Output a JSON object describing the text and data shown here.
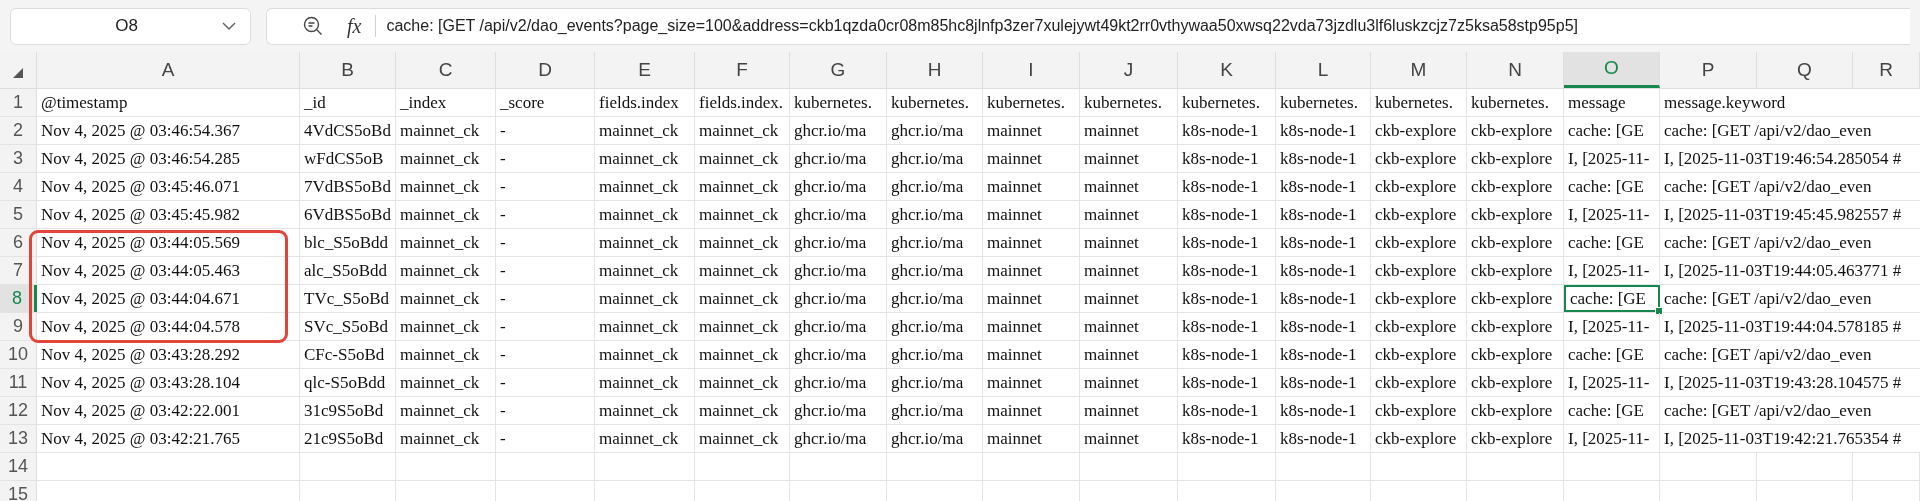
{
  "name_box": {
    "value": "O8"
  },
  "formula_bar": {
    "fx": "fx",
    "value": "cache: [GET /api/v2/dao_events?page_size=100&address=ckb1qzda0cr08m85hc8jlnfp3zer7xulejywt49kt2rr0vthywaa50xwsq22vda73jzdlu3lf6luskzcjz7z5ksa58stp95p5]"
  },
  "columns": [
    {
      "label": "A",
      "selected": false
    },
    {
      "label": "B",
      "selected": false
    },
    {
      "label": "C",
      "selected": false
    },
    {
      "label": "D",
      "selected": false
    },
    {
      "label": "E",
      "selected": false
    },
    {
      "label": "F",
      "selected": false
    },
    {
      "label": "G",
      "selected": false
    },
    {
      "label": "H",
      "selected": false
    },
    {
      "label": "I",
      "selected": false
    },
    {
      "label": "J",
      "selected": false
    },
    {
      "label": "K",
      "selected": false
    },
    {
      "label": "L",
      "selected": false
    },
    {
      "label": "M",
      "selected": false
    },
    {
      "label": "N",
      "selected": false
    },
    {
      "label": "O",
      "selected": true
    },
    {
      "label": "P",
      "selected": false
    },
    {
      "label": "Q",
      "selected": false
    },
    {
      "label": "R",
      "selected": false
    }
  ],
  "rows": [
    {
      "number": "1",
      "selected": false,
      "annotated": false,
      "cells": [
        "@timestamp",
        "_id",
        "_index",
        "_score",
        "fields.index",
        "fields.index.",
        "kubernetes.",
        "kubernetes.",
        "kubernetes.",
        "kubernetes.",
        "kubernetes.",
        "kubernetes.",
        "kubernetes.",
        "kubernetes.",
        "message",
        "message.keyword"
      ]
    },
    {
      "number": "2",
      "selected": false,
      "annotated": false,
      "cells": [
        "Nov 4, 2025 @ 03:46:54.367",
        "4VdCS5oBd",
        "mainnet_ck",
        "-",
        "mainnet_ck",
        "mainnet_ck",
        "ghcr.io/ma",
        "ghcr.io/ma",
        "mainnet",
        "mainnet",
        "k8s-node-1",
        "k8s-node-1",
        "ckb-explore",
        "ckb-explore",
        "cache: [GE",
        "cache: [GET /api/v2/dao_even"
      ]
    },
    {
      "number": "3",
      "selected": false,
      "annotated": false,
      "cells": [
        "Nov 4, 2025 @ 03:46:54.285",
        "wFdCS5oB",
        "mainnet_ck",
        "-",
        "mainnet_ck",
        "mainnet_ck",
        "ghcr.io/ma",
        "ghcr.io/ma",
        "mainnet",
        "mainnet",
        "k8s-node-1",
        "k8s-node-1",
        "ckb-explore",
        "ckb-explore",
        "I, [2025-11-",
        "I, [2025-11-03T19:46:54.285054 #"
      ]
    },
    {
      "number": "4",
      "selected": false,
      "annotated": false,
      "cells": [
        "Nov 4, 2025 @ 03:45:46.071",
        "7VdBS5oBd",
        "mainnet_ck",
        "-",
        "mainnet_ck",
        "mainnet_ck",
        "ghcr.io/ma",
        "ghcr.io/ma",
        "mainnet",
        "mainnet",
        "k8s-node-1",
        "k8s-node-1",
        "ckb-explore",
        "ckb-explore",
        "cache: [GE",
        "cache: [GET /api/v2/dao_even"
      ]
    },
    {
      "number": "5",
      "selected": false,
      "annotated": false,
      "cells": [
        "Nov 4, 2025 @ 03:45:45.982",
        "6VdBS5oBd",
        "mainnet_ck",
        "-",
        "mainnet_ck",
        "mainnet_ck",
        "ghcr.io/ma",
        "ghcr.io/ma",
        "mainnet",
        "mainnet",
        "k8s-node-1",
        "k8s-node-1",
        "ckb-explore",
        "ckb-explore",
        "I, [2025-11-",
        "I, [2025-11-03T19:45:45.982557 #"
      ]
    },
    {
      "number": "6",
      "selected": false,
      "annotated": true,
      "cells": [
        "Nov 4, 2025 @ 03:44:05.569",
        "blc_S5oBdd",
        "mainnet_ck",
        "-",
        "mainnet_ck",
        "mainnet_ck",
        "ghcr.io/ma",
        "ghcr.io/ma",
        "mainnet",
        "mainnet",
        "k8s-node-1",
        "k8s-node-1",
        "ckb-explore",
        "ckb-explore",
        "cache: [GE",
        "cache: [GET /api/v2/dao_even"
      ]
    },
    {
      "number": "7",
      "selected": false,
      "annotated": true,
      "cells": [
        "Nov 4, 2025 @ 03:44:05.463",
        "alc_S5oBdd",
        "mainnet_ck",
        "-",
        "mainnet_ck",
        "mainnet_ck",
        "ghcr.io/ma",
        "ghcr.io/ma",
        "mainnet",
        "mainnet",
        "k8s-node-1",
        "k8s-node-1",
        "ckb-explore",
        "ckb-explore",
        "I, [2025-11-",
        "I, [2025-11-03T19:44:05.463771 #"
      ]
    },
    {
      "number": "8",
      "selected": true,
      "annotated": true,
      "cells": [
        "Nov 4, 2025 @ 03:44:04.671",
        "TVc_S5oBd",
        "mainnet_ck",
        "-",
        "mainnet_ck",
        "mainnet_ck",
        "ghcr.io/ma",
        "ghcr.io/ma",
        "mainnet",
        "mainnet",
        "k8s-node-1",
        "k8s-node-1",
        "ckb-explore",
        "ckb-explore",
        "cache: [GE",
        "cache: [GET /api/v2/dao_even"
      ]
    },
    {
      "number": "9",
      "selected": false,
      "annotated": true,
      "cells": [
        "Nov 4, 2025 @ 03:44:04.578",
        "SVc_S5oBd",
        "mainnet_ck",
        "-",
        "mainnet_ck",
        "mainnet_ck",
        "ghcr.io/ma",
        "ghcr.io/ma",
        "mainnet",
        "mainnet",
        "k8s-node-1",
        "k8s-node-1",
        "ckb-explore",
        "ckb-explore",
        "I, [2025-11-",
        "I, [2025-11-03T19:44:04.578185 #"
      ]
    },
    {
      "number": "10",
      "selected": false,
      "annotated": false,
      "cells": [
        "Nov 4, 2025 @ 03:43:28.292",
        "CFc-S5oBd",
        "mainnet_ck",
        "-",
        "mainnet_ck",
        "mainnet_ck",
        "ghcr.io/ma",
        "ghcr.io/ma",
        "mainnet",
        "mainnet",
        "k8s-node-1",
        "k8s-node-1",
        "ckb-explore",
        "ckb-explore",
        "cache: [GE",
        "cache: [GET /api/v2/dao_even"
      ]
    },
    {
      "number": "11",
      "selected": false,
      "annotated": false,
      "cells": [
        "Nov 4, 2025 @ 03:43:28.104",
        "qlc-S5oBdd",
        "mainnet_ck",
        "-",
        "mainnet_ck",
        "mainnet_ck",
        "ghcr.io/ma",
        "ghcr.io/ma",
        "mainnet",
        "mainnet",
        "k8s-node-1",
        "k8s-node-1",
        "ckb-explore",
        "ckb-explore",
        "I, [2025-11-",
        "I, [2025-11-03T19:43:28.104575 #"
      ]
    },
    {
      "number": "12",
      "selected": false,
      "annotated": false,
      "cells": [
        "Nov 4, 2025 @ 03:42:22.001",
        "31c9S5oBd",
        "mainnet_ck",
        "-",
        "mainnet_ck",
        "mainnet_ck",
        "ghcr.io/ma",
        "ghcr.io/ma",
        "mainnet",
        "mainnet",
        "k8s-node-1",
        "k8s-node-1",
        "ckb-explore",
        "ckb-explore",
        "cache: [GE",
        "cache: [GET /api/v2/dao_even"
      ]
    },
    {
      "number": "13",
      "selected": false,
      "annotated": false,
      "cells": [
        "Nov 4, 2025 @ 03:42:21.765",
        "21c9S5oBd",
        "mainnet_ck",
        "-",
        "mainnet_ck",
        "mainnet_ck",
        "ghcr.io/ma",
        "ghcr.io/ma",
        "mainnet",
        "mainnet",
        "k8s-node-1",
        "k8s-node-1",
        "ckb-explore",
        "ckb-explore",
        "I, [2025-11-",
        "I, [2025-11-03T19:42:21.765354 #"
      ]
    },
    {
      "number": "14",
      "selected": false,
      "annotated": false
    },
    {
      "number": "15",
      "selected": false,
      "annotated": false
    }
  ]
}
